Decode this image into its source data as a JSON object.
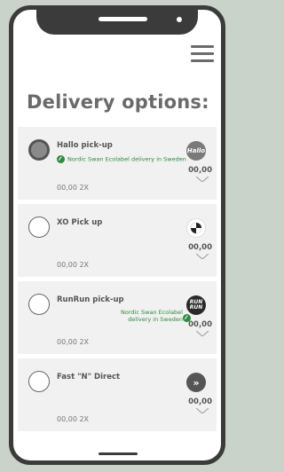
{
  "page": {
    "title": "Delivery options:"
  },
  "options": [
    {
      "name": "Hallo pick-up",
      "eco": "Nordic Swan Ecolabel delivery in Sweden",
      "qty": "00,00 2X",
      "price": "00,00",
      "logo_text": "Hallo",
      "selected": true
    },
    {
      "name": "XO Pick up",
      "eco": "",
      "qty": "00,00 2X",
      "price": "00,00",
      "logo_text": "",
      "selected": false
    },
    {
      "name": "RunRun pick-up",
      "eco_line1": "Nordic Swan Ecolabel",
      "eco_line2": "delivery in Sweden",
      "qty": "00,00 2X",
      "price": "00,00",
      "logo_text_1": "RUN",
      "logo_text_2": "RUN",
      "selected": false
    },
    {
      "name": "Fast \"N\" Direct",
      "eco": "",
      "qty": "00,00 2X",
      "price": "00,00",
      "logo_text": "»",
      "selected": false
    }
  ],
  "colors": {
    "background": "#c9d3c9",
    "eco_green": "#2e8b3e",
    "option_bg": "#f1f1f1"
  },
  "icons": {
    "menu": "hamburger-menu-icon",
    "chevron": "chevron-down-icon",
    "eco": "nordic-swan-leaf-icon"
  }
}
